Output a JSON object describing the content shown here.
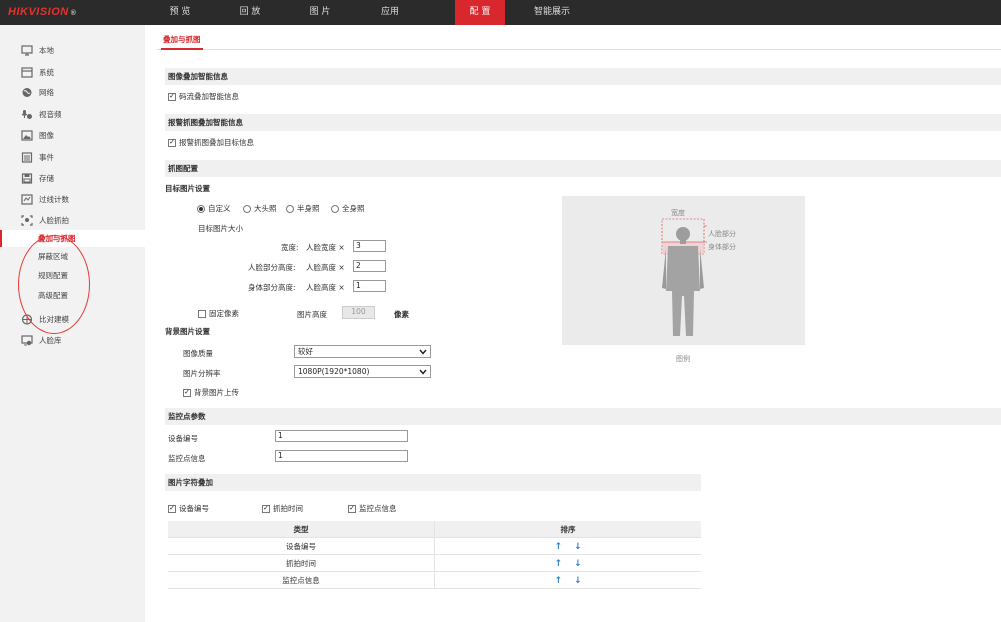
{
  "brand": {
    "logo": "HIKVISION",
    "reg": "®"
  },
  "topnav": [
    {
      "label": "预 览",
      "active": false
    },
    {
      "label": "回 放",
      "active": false
    },
    {
      "label": "图 片",
      "active": false
    },
    {
      "label": "应用",
      "active": false
    },
    {
      "label": "配 置",
      "active": true
    },
    {
      "label": "智能展示",
      "active": false
    }
  ],
  "sidebar": {
    "items": [
      {
        "label": "本地",
        "icon": "monitor-icon"
      },
      {
        "label": "系统",
        "icon": "system-icon"
      },
      {
        "label": "网络",
        "icon": "globe-icon"
      },
      {
        "label": "视音频",
        "icon": "audio-video-icon"
      },
      {
        "label": "图像",
        "icon": "image-icon"
      },
      {
        "label": "事件",
        "icon": "event-icon"
      },
      {
        "label": "存储",
        "icon": "storage-icon"
      },
      {
        "label": "过线计数",
        "icon": "line-count-icon"
      },
      {
        "label": "人脸抓拍",
        "icon": "face-capture-icon"
      }
    ],
    "sub_items": [
      {
        "label": "叠加与抓图",
        "active": true
      },
      {
        "label": "屏蔽区域",
        "active": false
      },
      {
        "label": "规则配置",
        "active": false
      },
      {
        "label": "高级配置",
        "active": false
      }
    ],
    "items_after": [
      {
        "label": "比对建模",
        "icon": "modeling-icon"
      },
      {
        "label": "人脸库",
        "icon": "face-library-icon"
      }
    ]
  },
  "tab": {
    "label": "叠加与抓图"
  },
  "overlay_section": {
    "title": "图像叠加智能信息",
    "checkbox_label": "码流叠加智能信息",
    "checked": true
  },
  "alarm_section": {
    "title": "报警抓图叠加智能信息",
    "checkbox_label": "报警抓图叠加目标信息",
    "checked": true
  },
  "capture_section": {
    "title": "抓图配置",
    "target_title": "目标图片设置",
    "radios": [
      {
        "label": "自定义",
        "checked": true
      },
      {
        "label": "大头照",
        "checked": false
      },
      {
        "label": "半身照",
        "checked": false
      },
      {
        "label": "全身照",
        "checked": false
      }
    ],
    "size_title": "目标图片大小",
    "width_label": "宽度:",
    "width_unit": "人脸宽度 ×",
    "width_value": "3",
    "face_height_label": "人脸部分高度:",
    "face_height_unit": "人脸高度 ×",
    "face_height_value": "2",
    "body_height_label": "身体部分高度:",
    "body_height_unit": "人脸高度 ×",
    "body_height_value": "1",
    "fixed_pixel_label": "固定像素",
    "fixed_pixel_checked": false,
    "img_height_label": "图片高度",
    "img_height_value": "100",
    "pixel_unit": "像素",
    "bg_title": "背景图片设置",
    "quality_label": "图像质量",
    "quality_value": "较好",
    "resolution_label": "图片分辨率",
    "resolution_value": "1080P(1920*1080)",
    "bg_upload_label": "背景图片上传",
    "bg_upload_checked": true
  },
  "preview": {
    "width_label": "宽度",
    "face_part_label": "人脸部分",
    "body_part_label": "身体部分",
    "caption": "图例"
  },
  "monitor_section": {
    "title": "监控点参数",
    "device_id_label": "设备编号",
    "device_id_value": "1",
    "monitor_info_label": "监控点信息",
    "monitor_info_value": "1"
  },
  "char_overlay_section": {
    "title": "图片字符叠加",
    "checkboxes": [
      {
        "label": "设备编号",
        "checked": true
      },
      {
        "label": "抓拍时间",
        "checked": true
      },
      {
        "label": "监控点信息",
        "checked": true
      }
    ],
    "table": {
      "headers": [
        "类型",
        "排序"
      ],
      "rows": [
        "设备编号",
        "抓拍时间",
        "监控点信息"
      ],
      "up_arrow": "↑",
      "down_arrow": "↓"
    }
  },
  "colors": {
    "accent": "#d9272e",
    "topbar": "#2b2b2b",
    "arrow": "#2f7fd6"
  }
}
